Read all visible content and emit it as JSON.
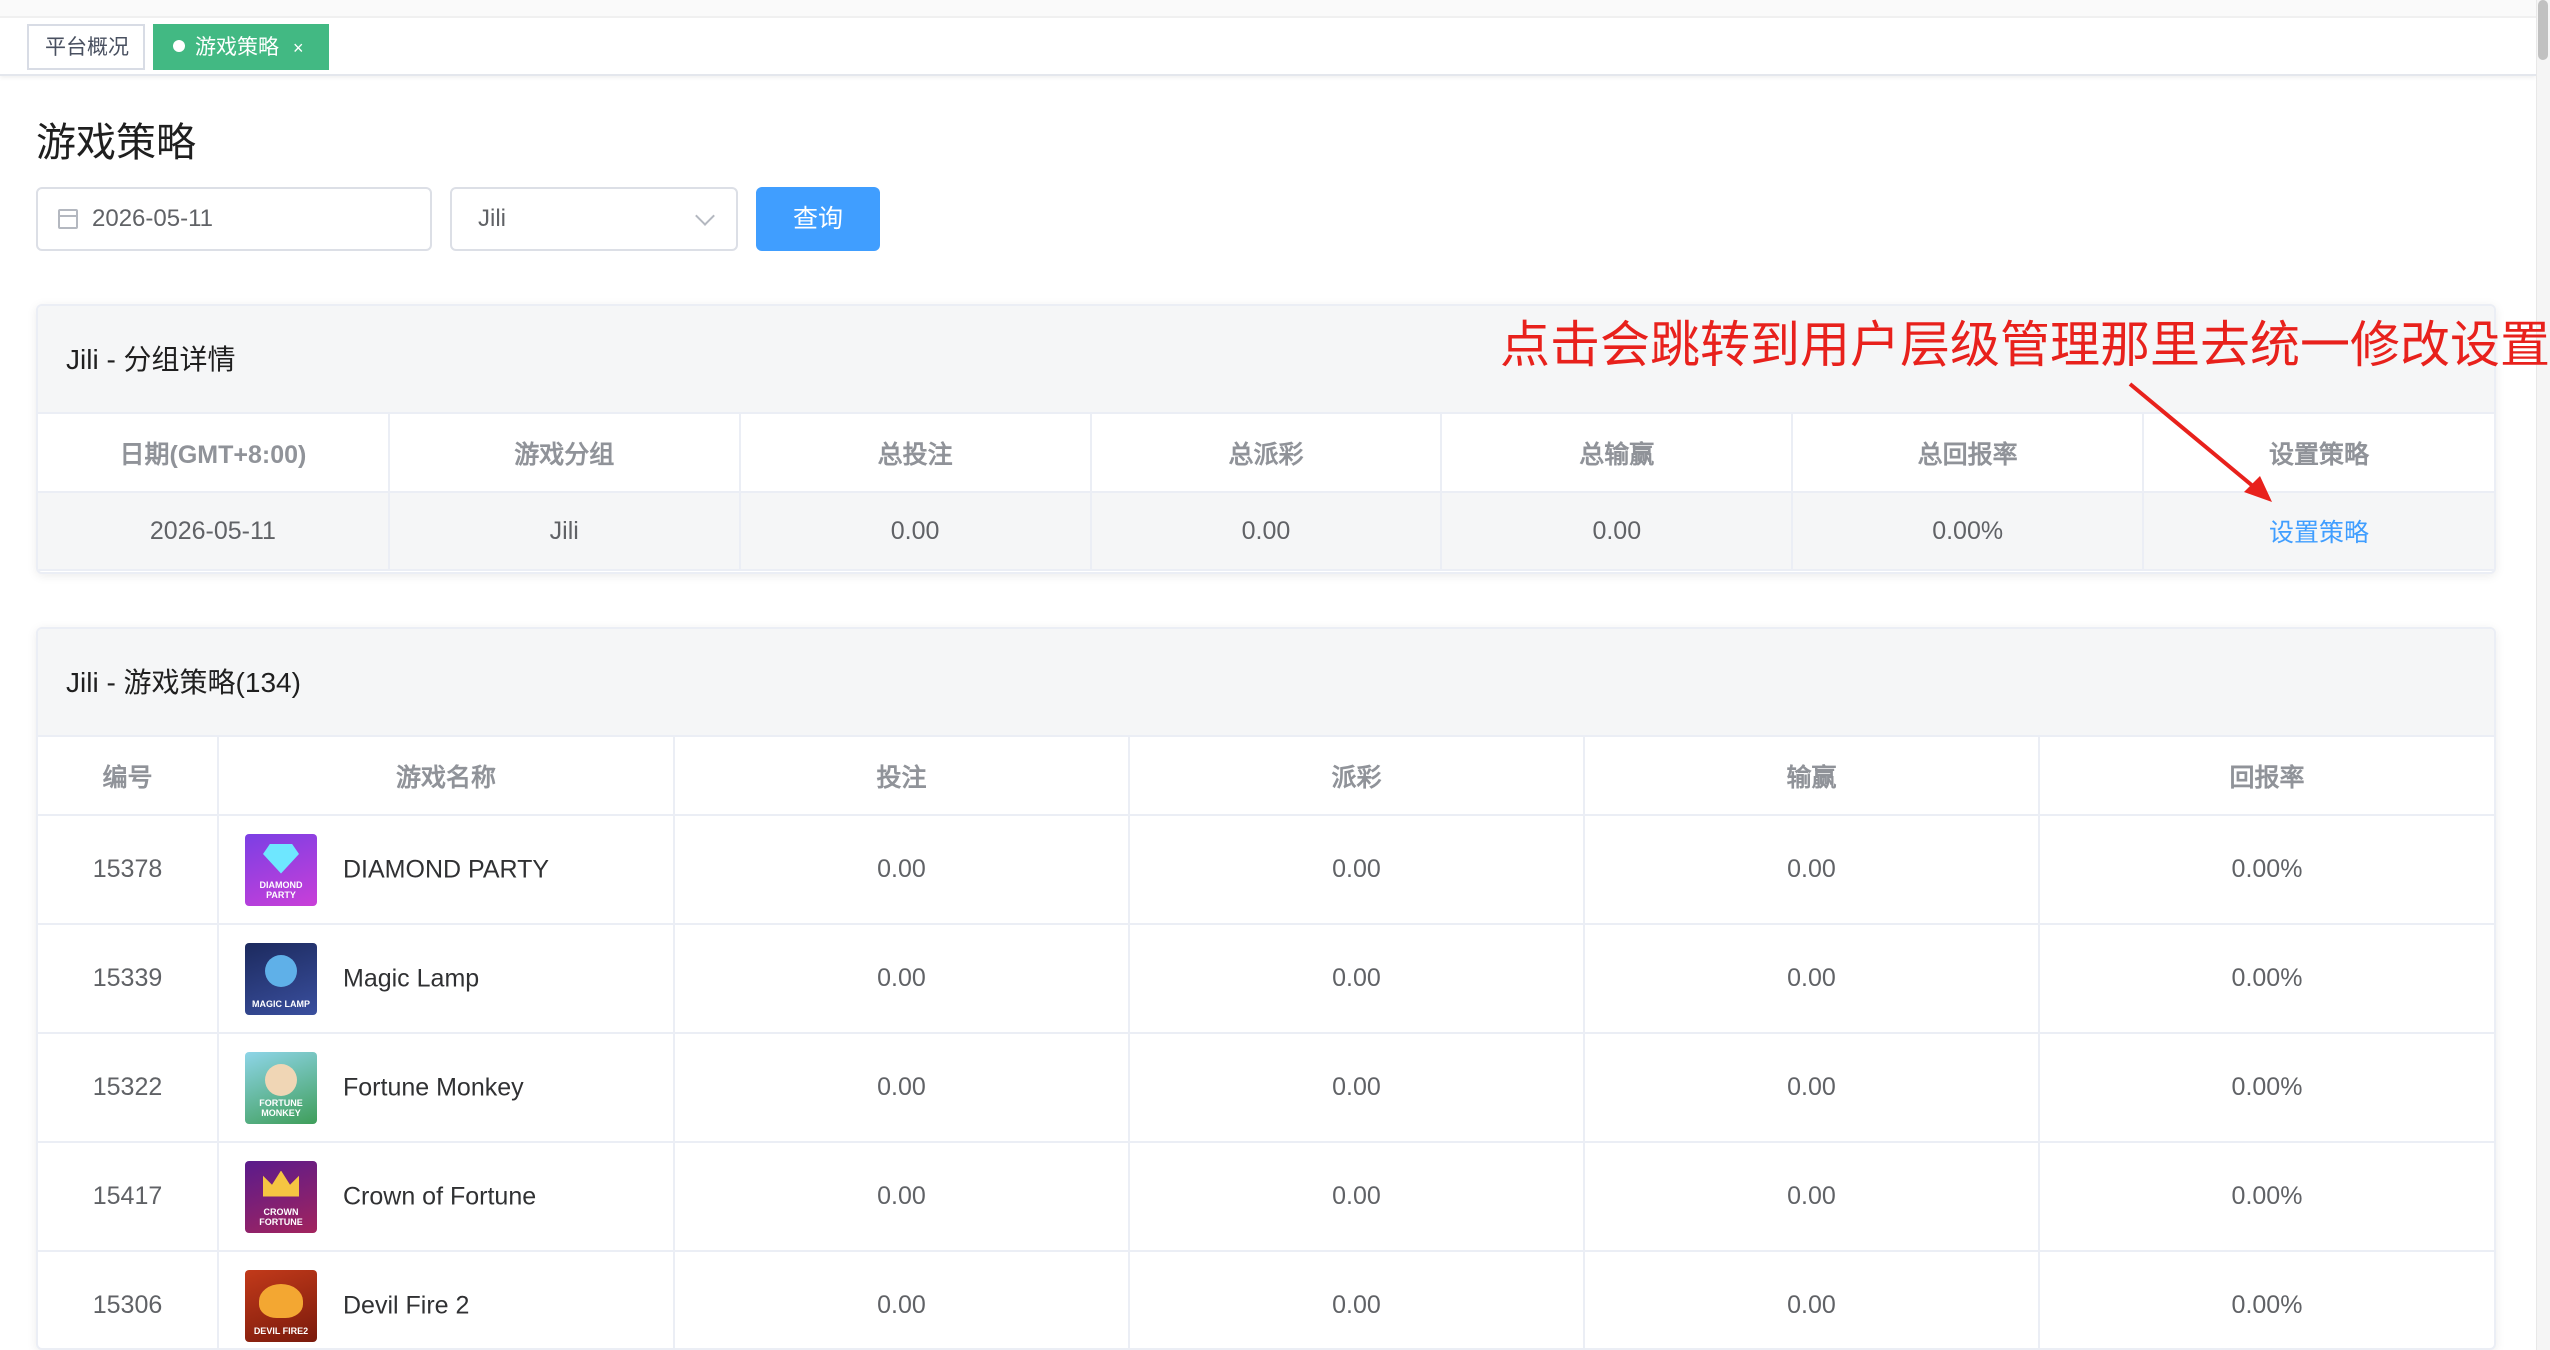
{
  "tabs": [
    {
      "label": "平台概况",
      "active": false
    },
    {
      "label": "游戏策略",
      "active": true,
      "close": "×"
    }
  ],
  "page_title": "游戏策略",
  "filters": {
    "date_value": "2026-05-11",
    "provider_value": "Jili",
    "query_label": "查询"
  },
  "group_card": {
    "title": "Jili - 分组详情",
    "columns": [
      "日期(GMT+8:00)",
      "游戏分组",
      "总投注",
      "总派彩",
      "总输赢",
      "总回报率",
      "设置策略"
    ],
    "row": {
      "date": "2026-05-11",
      "group": "Jili",
      "total_bet": "0.00",
      "total_payout": "0.00",
      "total_winloss": "0.00",
      "total_rtp": "0.00%",
      "action": "设置策略"
    }
  },
  "annotation": {
    "text": "点击会跳转到用户层级管理那里去统一修改设置",
    "color": "#e8211c"
  },
  "strategy_card": {
    "title": "Jili - 游戏策略(134)",
    "columns": [
      "编号",
      "游戏名称",
      "投注",
      "派彩",
      "输赢",
      "回报率"
    ],
    "rows": [
      {
        "id": "15378",
        "name": "DIAMOND PARTY",
        "thumb_label": "DIAMOND PARTY",
        "bet": "0.00",
        "payout": "0.00",
        "winloss": "0.00",
        "rtp": "0.00%"
      },
      {
        "id": "15339",
        "name": "Magic Lamp",
        "thumb_label": "MAGIC LAMP",
        "bet": "0.00",
        "payout": "0.00",
        "winloss": "0.00",
        "rtp": "0.00%"
      },
      {
        "id": "15322",
        "name": "Fortune Monkey",
        "thumb_label": "FORTUNE MONKEY",
        "bet": "0.00",
        "payout": "0.00",
        "winloss": "0.00",
        "rtp": "0.00%"
      },
      {
        "id": "15417",
        "name": "Crown of Fortune",
        "thumb_label": "CROWN FORTUNE",
        "bet": "0.00",
        "payout": "0.00",
        "winloss": "0.00",
        "rtp": "0.00%"
      },
      {
        "id": "15306",
        "name": "Devil Fire 2",
        "thumb_label": "DEVIL FIRE2",
        "bet": "0.00",
        "payout": "0.00",
        "winloss": "0.00",
        "rtp": "0.00%"
      }
    ]
  },
  "colors": {
    "accent": "#409eff",
    "active_tab": "#42b983"
  }
}
